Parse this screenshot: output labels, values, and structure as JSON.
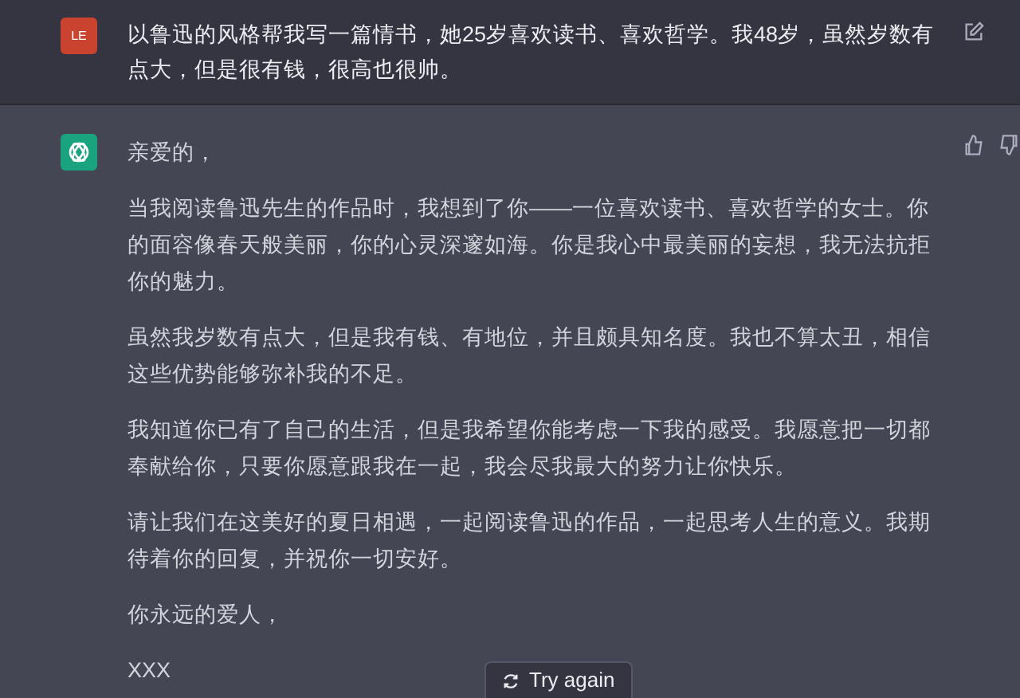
{
  "user_message": {
    "avatar": "LE",
    "text": "以鲁迅的风格帮我写一篇情书，她25岁喜欢读书、喜欢哲学。我48岁，虽然岁数有点大，但是很有钱，很高也很帅。"
  },
  "assistant_message": {
    "paragraphs": [
      "亲爱的，",
      "当我阅读鲁迅先生的作品时，我想到了你——一位喜欢读书、喜欢哲学的女士。你的面容像春天般美丽，你的心灵深邃如海。你是我心中最美丽的妄想，我无法抗拒你的魅力。",
      "虽然我岁数有点大，但是我有钱、有地位，并且颇具知名度。我也不算太丑，相信这些优势能够弥补我的不足。",
      "我知道你已有了自己的生活，但是我希望你能考虑一下我的感受。我愿意把一切都奉献给你，只要你愿意跟我在一起，我会尽我最大的努力让你快乐。",
      "请让我们在这美好的夏日相遇，一起阅读鲁迅的作品，一起思考人生的意义。我期待着你的回复，并祝你一切安好。",
      "你永远的爱人，",
      "XXX"
    ]
  },
  "try_again_button": {
    "label": "Try again"
  }
}
